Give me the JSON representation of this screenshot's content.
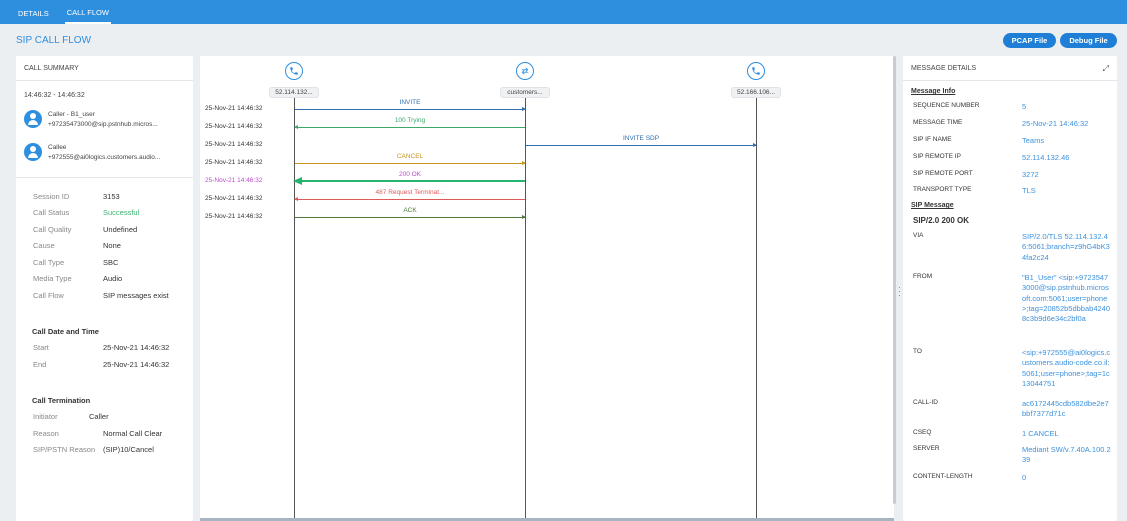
{
  "nav": {
    "tabs": [
      "DETAILS",
      "CALL FLOW"
    ]
  },
  "page": {
    "title": "SIP CALL FLOW",
    "pcap_label": "PCAP File",
    "debug_label": "Debug File"
  },
  "summary": {
    "header": "CALL SUMMARY",
    "time_range": "14:46:32 - 14:46:32",
    "caller": {
      "name": "Caller - B1_user",
      "uri": "+97235473000@sip.pstnhub.micros..."
    },
    "callee": {
      "name": "Callee",
      "uri": "+972555@ai0logics.customers.audio..."
    },
    "fields": [
      {
        "label": "Session ID",
        "value": "3153"
      },
      {
        "label": "Call Status",
        "value": "Successful"
      },
      {
        "label": "Call Quality",
        "value": "Undefined"
      },
      {
        "label": "Cause",
        "value": "None"
      },
      {
        "label": "Call Type",
        "value": "SBC"
      },
      {
        "label": "Media Type",
        "value": "Audio"
      },
      {
        "label": "Call Flow",
        "value": "SIP messages exist"
      }
    ],
    "date_section": "Call Date and Time",
    "dates": [
      {
        "label": "Start",
        "value": "25-Nov-21 14:46:32"
      },
      {
        "label": "End",
        "value": "25-Nov-21 14:46:32"
      }
    ],
    "term_section": "Call Termination",
    "termination": [
      {
        "label": "Initiator",
        "value": "Caller"
      },
      {
        "label": "Reason",
        "value": "Normal Call Clear"
      },
      {
        "label": "SIP/PSTN Reason",
        "value": "(SIP)10/Cancel"
      }
    ]
  },
  "flow": {
    "endpoints": [
      {
        "label": "52.114.132...",
        "icon": "phone-icon"
      },
      {
        "label": "customers...",
        "icon": "sbc-transfer-icon"
      },
      {
        "label": "52.166.106...",
        "icon": "phone-icon"
      }
    ],
    "messages": [
      {
        "time": "25-Nov-21 14:46:32",
        "label": "INVITE",
        "color": "#2f6fb0"
      },
      {
        "time": "25-Nov-21 14:46:32",
        "label": "100 Trying",
        "color": "#3ca86a"
      },
      {
        "time": "25-Nov-21 14:46:32",
        "label": "INVITE SDP",
        "color": "#2f6fb0"
      },
      {
        "time": "25-Nov-21 14:46:32",
        "label": "CANCEL",
        "color": "#c8941f"
      },
      {
        "time": "25-Nov-21 14:46:32",
        "label": "200 OK",
        "color": "#c04ad0",
        "highlight_line": "#26b36e"
      },
      {
        "time": "25-Nov-21 14:46:32",
        "label": "487 Request Terminat...",
        "color": "#e05a5a"
      },
      {
        "time": "25-Nov-21 14:46:32",
        "label": "ACK",
        "color": "#4f7a3a"
      }
    ]
  },
  "details": {
    "header": "MESSAGE DETAILS",
    "info_section": "Message Info",
    "info": [
      {
        "label": "SEQUENCE NUMBER",
        "value": "5"
      },
      {
        "label": "MESSAGE TIME",
        "value": "25-Nov-21 14:46:32"
      },
      {
        "label": "SIP IF NAME",
        "value": "Teams"
      },
      {
        "label": "SIP REMOTE IP",
        "value": "52.114.132.46"
      },
      {
        "label": "SIP REMOTE PORT",
        "value": "3272"
      },
      {
        "label": "TRANSPORT TYPE",
        "value": "TLS"
      }
    ],
    "sip_section": "SIP Message",
    "status_line": "SIP/2.0 200 OK",
    "sip": [
      {
        "label": "VIA",
        "value": "SIP/2.0/TLS 52.114.132.46:5061;branch=z9hG4bK34fa2c24"
      },
      {
        "label": "FROM",
        "value": "\"B1_User\" <sip:+97235473000@sip.pstnhub.microsoft.com:5061;user=phone>;tag=20852b5dbbab42408c3b9d6e34c2bf0a"
      },
      {
        "label": "TO",
        "value": "<sip:+972555@ai0logics.customers.audio-code.co.il:5061;user=phone>;tag=1c13044751"
      },
      {
        "label": "CALL-ID",
        "value": "ac6172445cdb582dbe2e7bbf7377d71c"
      },
      {
        "label": "CSEQ",
        "value": "1 CANCEL"
      },
      {
        "label": "SERVER",
        "value": "Mediant SW/v.7.40A.100.239"
      },
      {
        "label": "CONTENT-LENGTH",
        "value": "0"
      }
    ]
  },
  "colors": {
    "accent": "#2f8fdf",
    "success": "#3cb371"
  }
}
